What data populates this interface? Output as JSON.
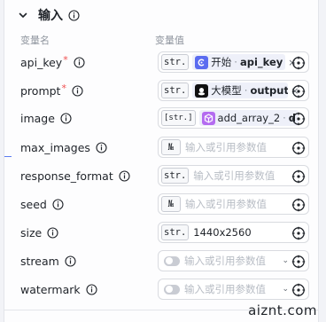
{
  "section": {
    "title": "输入"
  },
  "columns": {
    "name": "变量名",
    "value": "变量值"
  },
  "rows": [
    {
      "name": "api_key",
      "required": "*",
      "type": "str.",
      "ref_node": "开始",
      "ref_sep": " · ",
      "ref_var": "api_key",
      "clear": "×"
    },
    {
      "name": "prompt",
      "required": "*",
      "type": "str.",
      "ref_node": "大模型",
      "ref_sep": " · ",
      "ref_var": "output",
      "clear": "×"
    },
    {
      "name": "image",
      "type": "[str.]",
      "ref_node": "add_array_2",
      "ref_sep": " · ",
      "ref_var": "d"
    },
    {
      "name": "max_images",
      "type": "№",
      "placeholder": "输入或引用参数值"
    },
    {
      "name": "response_format",
      "type": "str.",
      "placeholder": "输入或引用参数值"
    },
    {
      "name": "seed",
      "type": "№",
      "placeholder": "输入或引用参数值"
    },
    {
      "name": "size",
      "type": "str.",
      "value": "1440x2560"
    },
    {
      "name": "stream",
      "placeholder": "输入或引用参数值"
    },
    {
      "name": "watermark",
      "placeholder": "输入或引用参数值"
    }
  ],
  "icons": {
    "section_toggle": "chevron-down-icon",
    "info": "info-icon",
    "target": "crosshair-icon",
    "start_node": "start-node-icon",
    "llm_node": "llm-node-icon",
    "array_node": "array-node-icon"
  },
  "colors": {
    "start_node": "#5b6cf0",
    "llm_node": "#111111",
    "array_node": "#b46cf0",
    "required": "#f04e4e"
  },
  "watermark": "aiznt.com"
}
